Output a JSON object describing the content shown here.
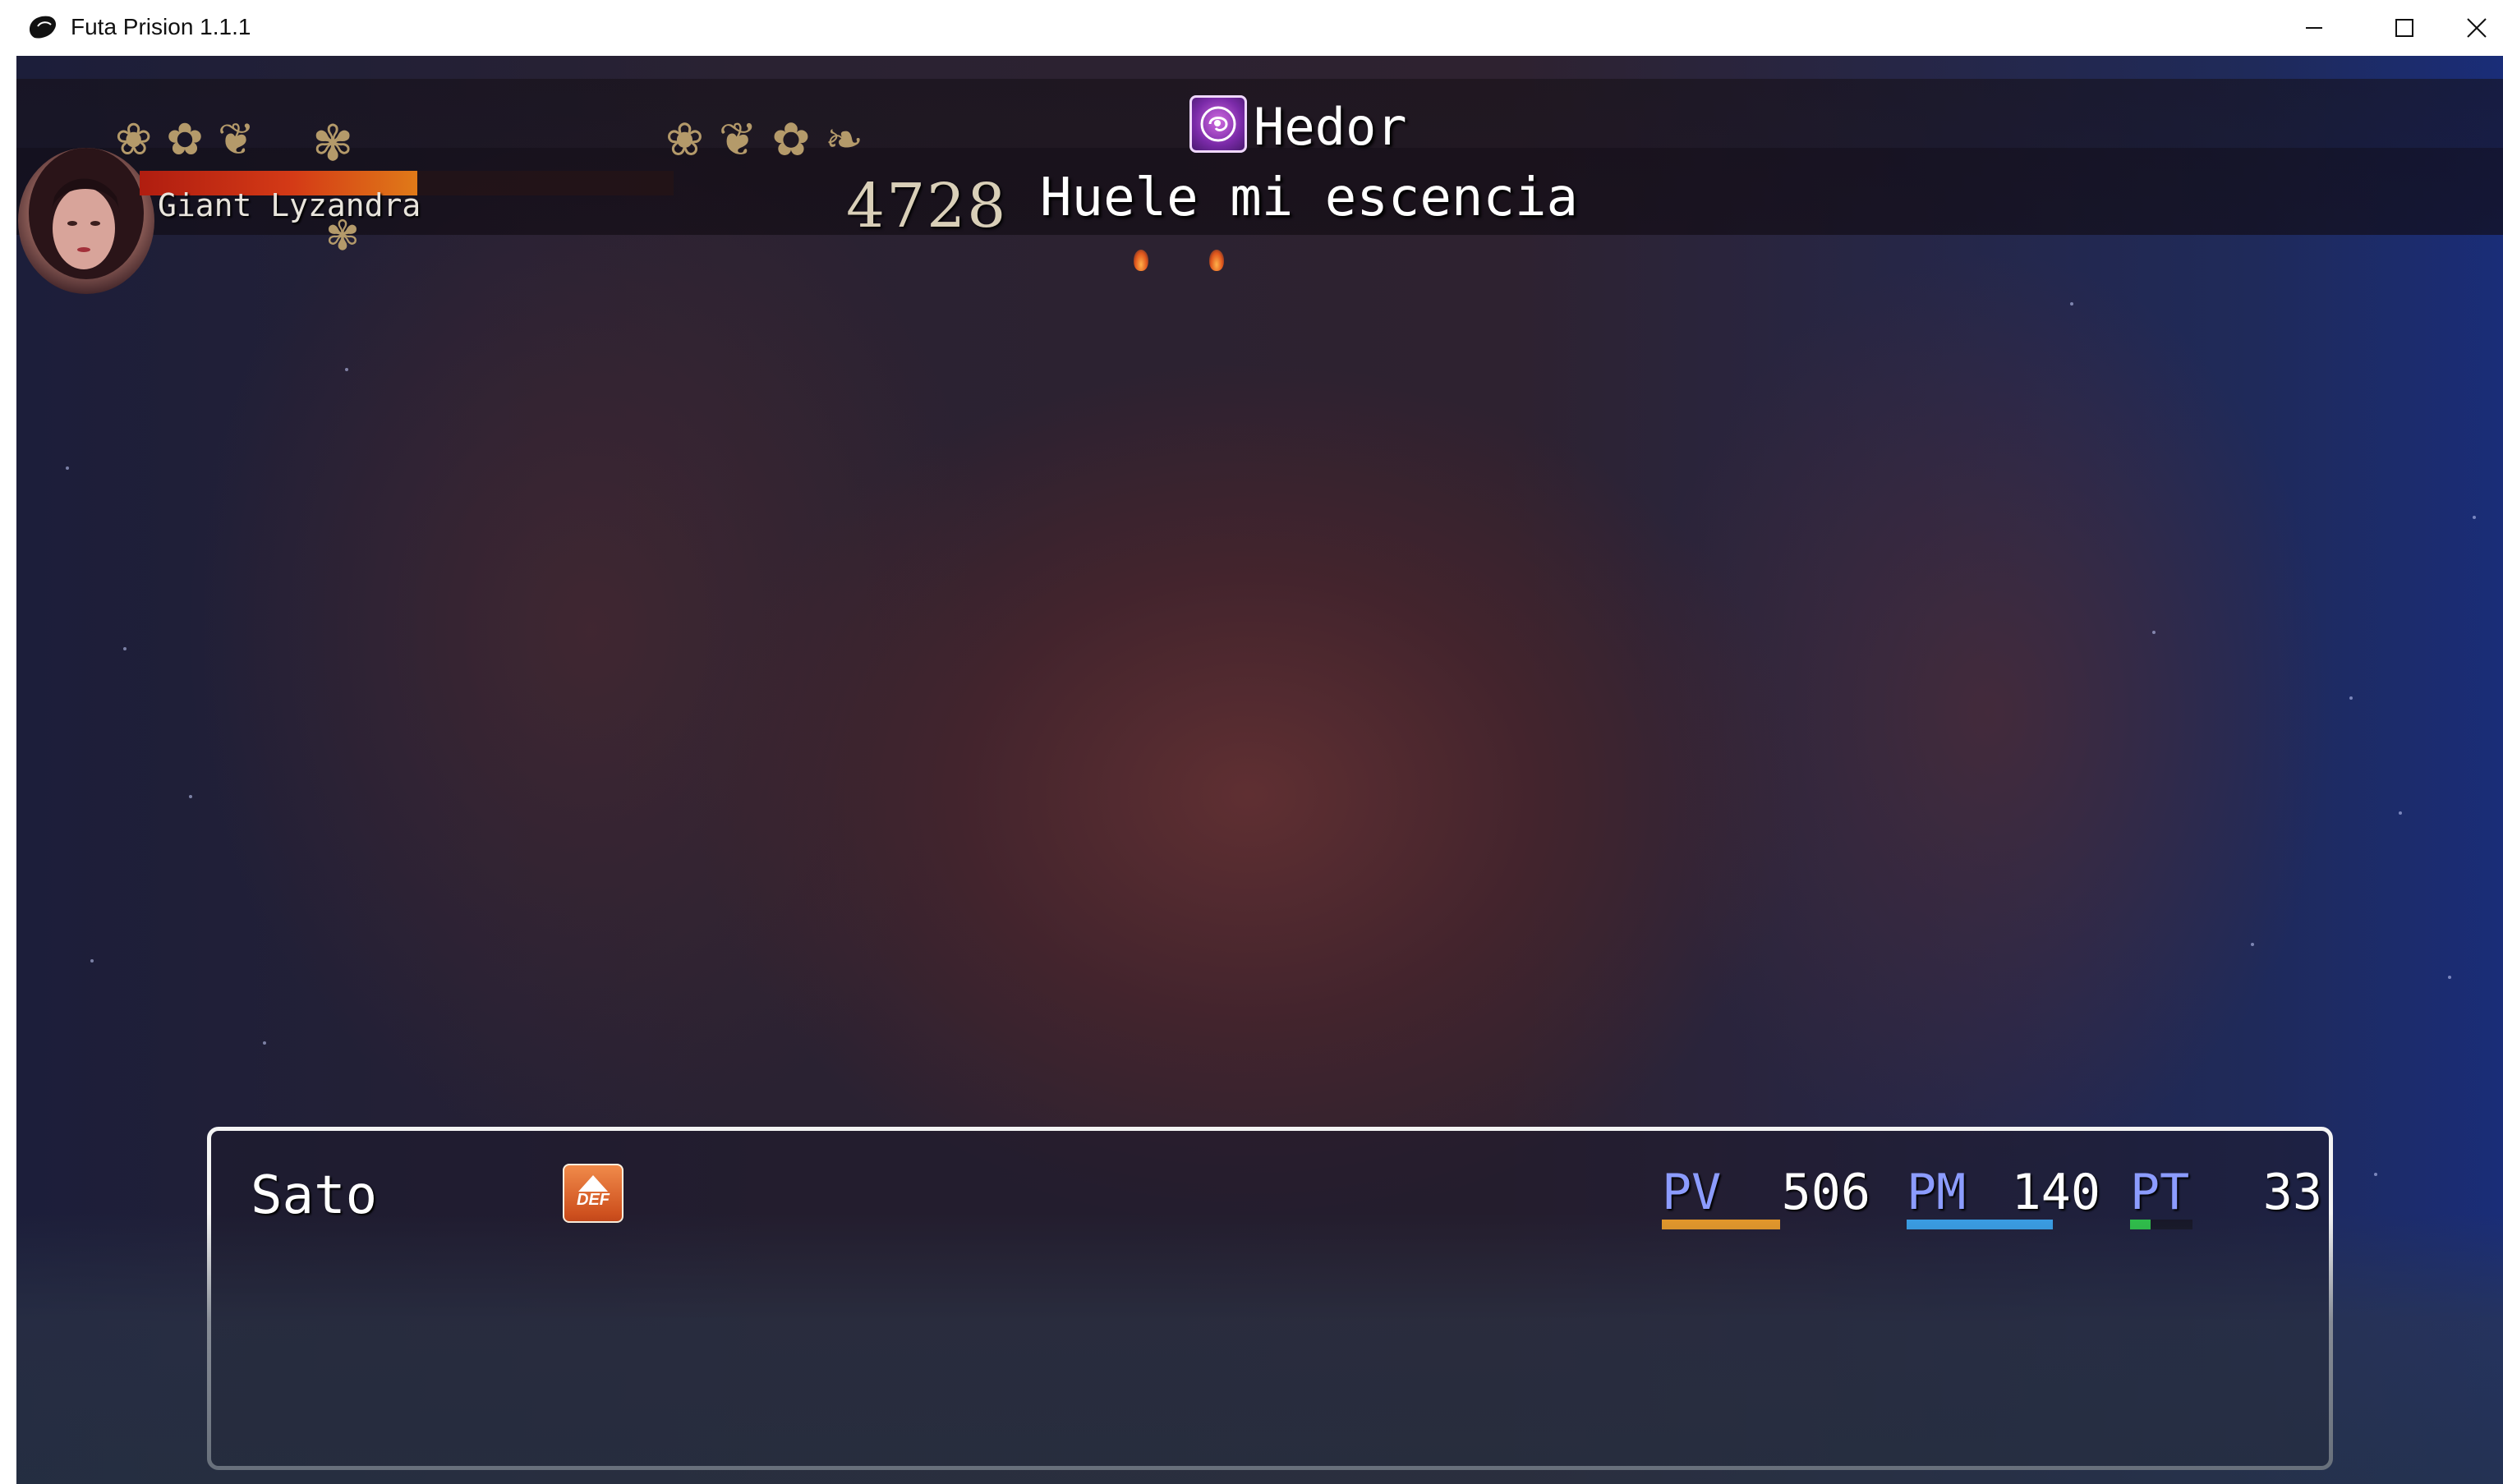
{
  "window": {
    "title": "Futa Prision 1.1.1"
  },
  "icons": {
    "app": "app-logo-icon",
    "minimize": "minimize-icon",
    "maximize": "maximize-icon",
    "close": "close-icon",
    "skill": "skill-hedor-icon",
    "state": "defense-up-icon"
  },
  "enemy": {
    "name": "Giant Lyzandra",
    "hp_value": "4728",
    "hp_fraction": 0.52
  },
  "skill": {
    "name": "Hedor",
    "message": "Huele mi escencia"
  },
  "actor": {
    "name": "Sato",
    "state_label": "DEF",
    "pv_label": "PV",
    "pv_value": "506",
    "pv_fraction": 1.0,
    "pm_label": "PM",
    "pm_value": "140",
    "pm_fraction": 1.0,
    "pt_label": "PT",
    "pt_value": "33",
    "pt_fraction": 0.33
  },
  "colors": {
    "pv_label": "#8c9cff",
    "pm_label": "#8c9cff",
    "pt_label": "#8c9cff",
    "pv_bar": "#e89a2a",
    "pm_bar": "#3aa0e8",
    "pt_bar": "#2fc24a",
    "boss_hp": "#d43a16"
  }
}
